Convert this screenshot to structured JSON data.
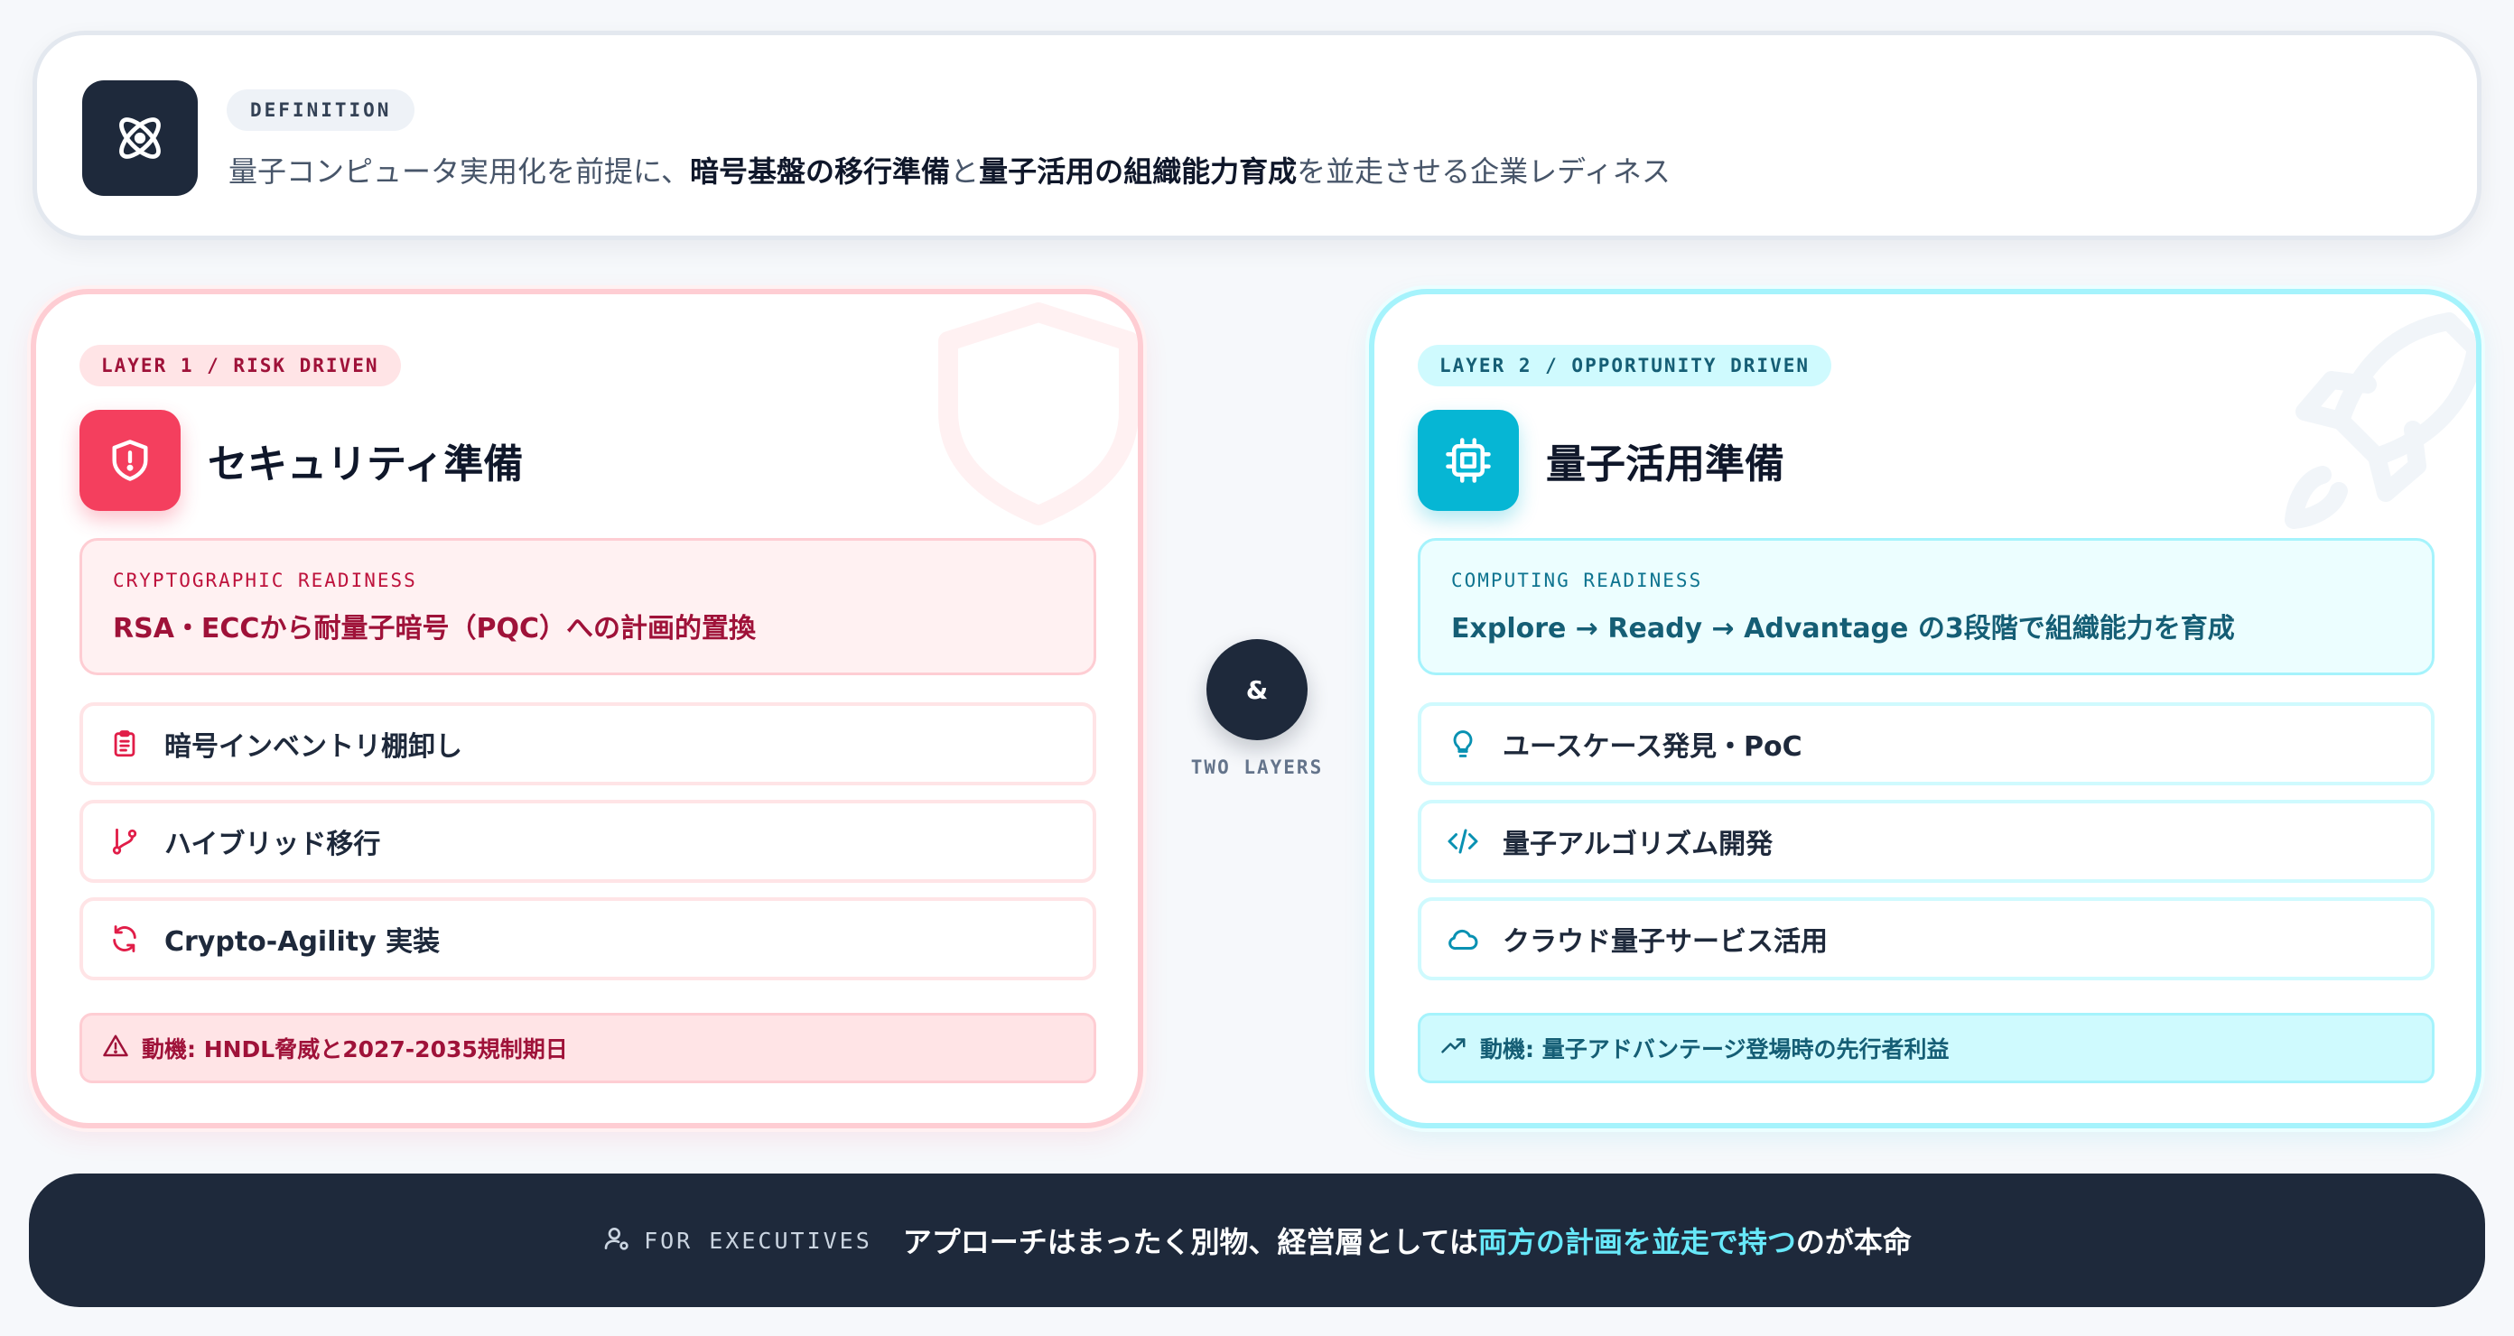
{
  "definition": {
    "badge": "DEFINITION",
    "text_pre": "量子コンピュータ実用化を前提に、",
    "text_bold1": "暗号基盤の移行準備",
    "text_mid": "と",
    "text_bold2": "量子活用の組織能力育成",
    "text_post": "を並走させる企業レディネス"
  },
  "layer1": {
    "badge": "LAYER 1 / RISK DRIVEN",
    "title": "セキュリティ準備",
    "readiness_label": "CRYPTOGRAPHIC READINESS",
    "readiness_text": "RSA・ECCから耐量子暗号（PQC）への計画的置換",
    "items": [
      {
        "label": "暗号インベントリ棚卸し",
        "icon": "clipboard-list-icon"
      },
      {
        "label": "ハイブリッド移行",
        "icon": "git-branch-icon"
      },
      {
        "label": "Crypto-Agility 実装",
        "icon": "refresh-icon"
      }
    ],
    "motive": "動機: HNDL脅威と2027-2035規制期日"
  },
  "layer2": {
    "badge": "LAYER 2 / OPPORTUNITY DRIVEN",
    "title": "量子活用準備",
    "readiness_label": "COMPUTING READINESS",
    "readiness_text": "Explore → Ready → Advantage の3段階で組織能力を育成",
    "items": [
      {
        "label": "ユースケース発見・PoC",
        "icon": "lightbulb-icon"
      },
      {
        "label": "量子アルゴリズム開発",
        "icon": "code-icon"
      },
      {
        "label": "クラウド量子サービス活用",
        "icon": "cloud-icon"
      }
    ],
    "motive": "動機: 量子アドバンテージ登場時の先行者利益"
  },
  "connector": {
    "symbol": "&",
    "label": "TWO LAYERS"
  },
  "executives": {
    "label": "FOR EXECUTIVES",
    "msg_pre": "アプローチはまったく別物、経営層としては",
    "msg_highlight": "両方の計画を並走で持つ",
    "msg_post": "のが本命"
  },
  "colors": {
    "dark": "#1e293b",
    "risk_accent": "#f43f5e",
    "opportunity_accent": "#06b6d4",
    "highlight": "#67e8f9"
  }
}
